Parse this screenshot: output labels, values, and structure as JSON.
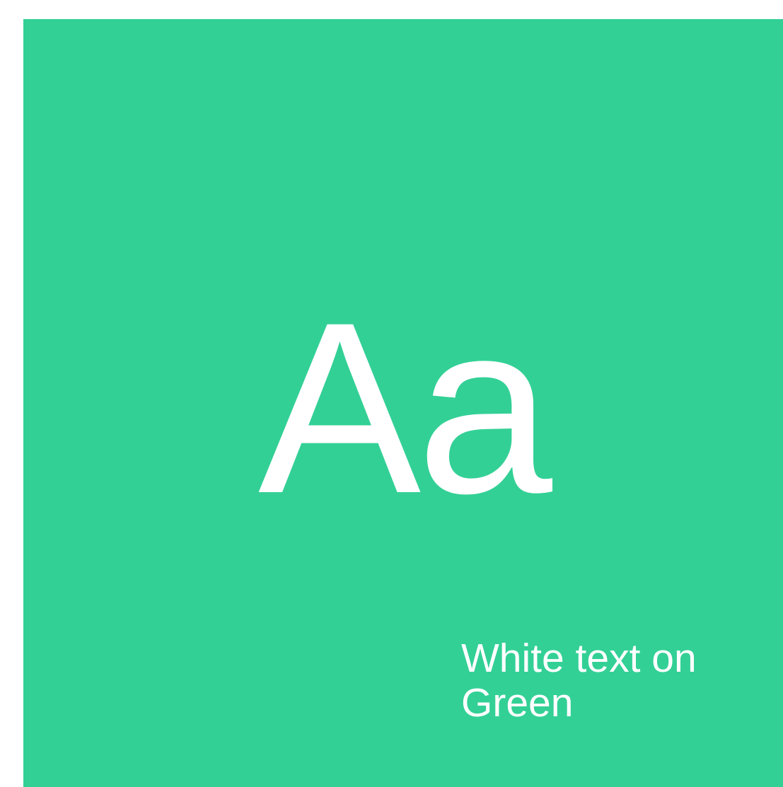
{
  "swatch": {
    "background_color": "#33d096",
    "text_color": "#ffffff",
    "sample_text": "Aa",
    "caption": "White text on Green"
  }
}
